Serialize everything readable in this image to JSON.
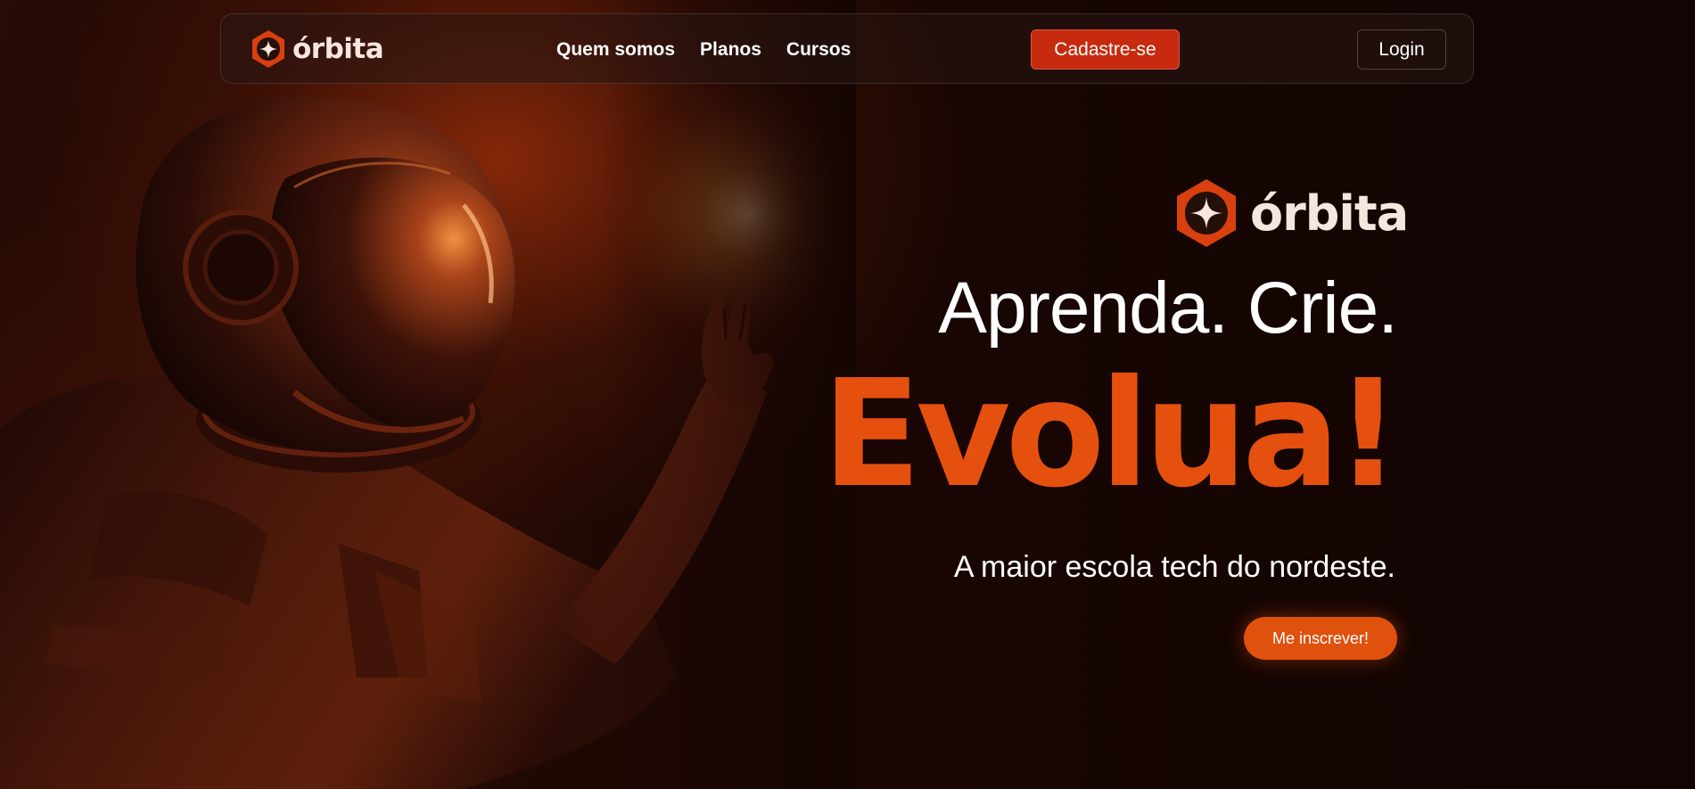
{
  "nav": {
    "brand": "órbita",
    "links": [
      "Quem somos",
      "Planos",
      "Cursos"
    ],
    "signup_label": "Cadastre-se",
    "login_label": "Login"
  },
  "hero": {
    "brand": "órbita",
    "headline_line1": "Aprenda. Crie.",
    "headline_line2": "Evolua!",
    "subtitle": "A maior escola tech do nordeste.",
    "cta_label": "Me inscrever!"
  },
  "colors": {
    "accent": "#e6500f",
    "button_red": "#c72a0e",
    "background": "#120503",
    "brand_text": "#f6e6de"
  },
  "icons": {
    "logo": "orbita-hexagon-star-icon",
    "hero_image": "astronaut-illustration"
  }
}
